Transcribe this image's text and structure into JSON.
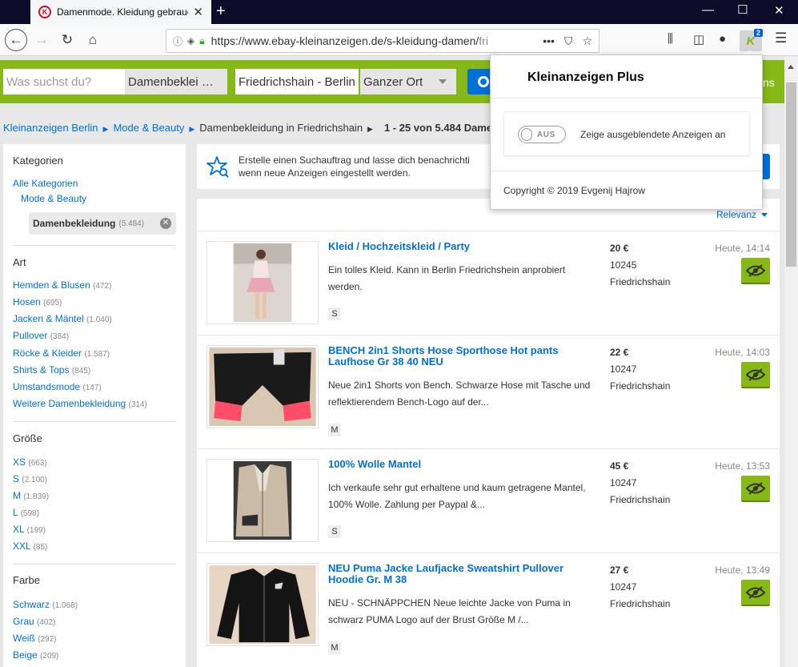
{
  "browser": {
    "tab_title": "Damenmode. Kleidung gebrauc",
    "url_main": "https://www.ebay-kleinanzeigen.de/s-kleidung-damen/",
    "url_rest": "fri",
    "ext_badge": "2",
    "ext_letter": "K"
  },
  "header": {
    "search_placeholder": "Was suchst du?",
    "category": "Damenbeklei …",
    "location": "Friedrichshain - Berlin",
    "radius": "Ganzer Ort",
    "right_text": "ns"
  },
  "breadcrumb": {
    "items": [
      "Kleinanzeigen Berlin",
      "Mode & Beauty"
    ],
    "current": "Damenbekleidung in Friedrichshain",
    "count": "1 - 25 von 5.484 Damen"
  },
  "sidebar": {
    "categories": {
      "title": "Kategorien",
      "all": "Alle Kategorien",
      "parent": "Mode & Beauty",
      "selected": "Damenbekleidung",
      "selected_count": "(5.484)"
    },
    "art": {
      "title": "Art",
      "items": [
        {
          "label": "Hemden & Blusen",
          "count": "(472)"
        },
        {
          "label": "Hosen",
          "count": "(695)"
        },
        {
          "label": "Jacken & Mäntel",
          "count": "(1.040)"
        },
        {
          "label": "Pullover",
          "count": "(384)"
        },
        {
          "label": "Röcke & Kleider",
          "count": "(1.587)"
        },
        {
          "label": "Shirts & Tops",
          "count": "(845)"
        },
        {
          "label": "Umstandsmode",
          "count": "(147)"
        },
        {
          "label": "Weitere Damenbekleidung",
          "count": "(314)"
        }
      ]
    },
    "size": {
      "title": "Größe",
      "items": [
        {
          "label": "XS",
          "count": "(663)"
        },
        {
          "label": "S",
          "count": "(2.100)"
        },
        {
          "label": "M",
          "count": "(1.839)"
        },
        {
          "label": "L",
          "count": "(598)"
        },
        {
          "label": "XL",
          "count": "(199)"
        },
        {
          "label": "XXL",
          "count": "(85)"
        }
      ]
    },
    "color": {
      "title": "Farbe",
      "items": [
        {
          "label": "Schwarz",
          "count": "(1.068)"
        },
        {
          "label": "Grau",
          "count": "(402)"
        },
        {
          "label": "Weiß",
          "count": "(292)"
        },
        {
          "label": "Beige",
          "count": "(209)"
        }
      ]
    }
  },
  "notice": {
    "line1": "Erstelle einen Suchauftrag und lasse dich benachrichti",
    "line2": "wenn neue Anzeigen eingestellt werden."
  },
  "results": {
    "sort_label": "Relevanz",
    "items": [
      {
        "title": "Kleid / Hochzeitskleid / Party",
        "desc": "Ein tolles Kleid. Kann in Berlin Friedrichshein anprobiert werden.",
        "size": "S",
        "price": "20 €",
        "zip": "10245",
        "city": "Friedrichshain",
        "date": "Heute, 14:14"
      },
      {
        "title": "BENCH 2in1 Shorts Hose Sporthose Hot pants Laufhose Gr 38 40 NEU",
        "desc": "Neue 2in1 Shorts von Bench. Schwarze Hose mit Tasche und reflektierendem Bench-Logo auf der...",
        "size": "M",
        "price": "22 €",
        "zip": "10247",
        "city": "Friedrichshain",
        "date": "Heute, 14:03"
      },
      {
        "title": "100% Wolle Mantel",
        "desc": "Ich verkaufe sehr gut erhaltene und kaum getragene Mantel, 100% Wolle. Zahlung per Paypal &...",
        "size": "S",
        "price": "45 €",
        "zip": "10247",
        "city": "Friedrichshain",
        "date": "Heute, 13:53"
      },
      {
        "title": "NEU Puma Jacke Laufjacke Sweatshirt Pullover Hoodie Gr. M 38",
        "desc": "NEU - SCHNÄPPCHEN Neue leichte Jacke von Puma in schwarz PUMA Logo auf der Brust Größe M /...",
        "size": "M",
        "price": "27 €",
        "zip": "10247",
        "city": "Friedrichshain",
        "date": "Heute, 13:49"
      }
    ]
  },
  "popup": {
    "title": "Kleinanzeigen Plus",
    "toggle_label": "AUS",
    "option_label": "Zeige ausgeblendete Anzeigen an",
    "copyright": "Copyright © 2019 Evgenij Hajrow"
  }
}
